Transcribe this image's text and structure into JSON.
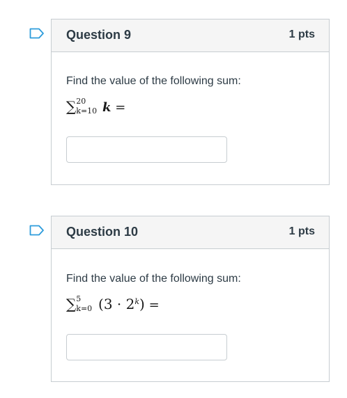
{
  "questions": [
    {
      "title": "Question 9",
      "points": "1 pts",
      "prompt": "Find the value of the following sum:",
      "math": {
        "sigma": "∑",
        "upper": "20",
        "lower": "k=10",
        "expression": "k",
        "equals": "="
      },
      "answer_value": ""
    },
    {
      "title": "Question 10",
      "points": "1 pts",
      "prompt": "Find the value of the following sum:",
      "math": {
        "sigma": "∑",
        "upper": "5",
        "lower": "k=0",
        "expression": "(3 · 2",
        "exponent": "k",
        "close": ")",
        "equals": "="
      },
      "answer_value": ""
    }
  ],
  "colors": {
    "flag": "#2d9cdb",
    "border": "#c7cdd1",
    "header_bg": "#f5f5f5",
    "text": "#2d3b45"
  },
  "icons": {
    "flag": "bookmark-flag-icon"
  }
}
